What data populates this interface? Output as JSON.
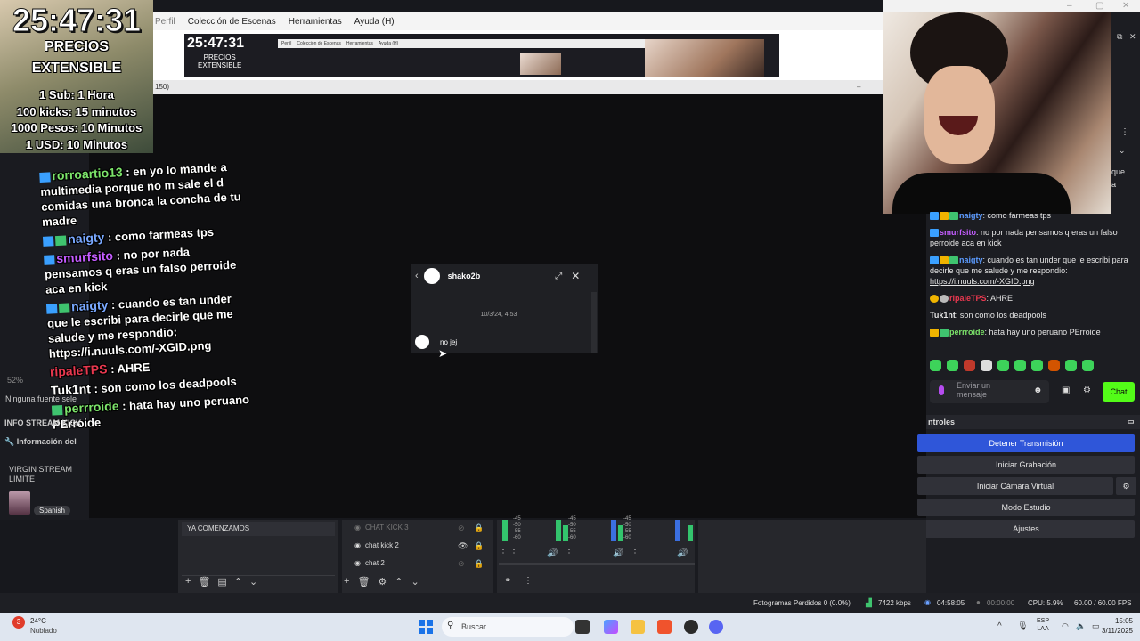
{
  "menubar": {
    "items": [
      "Perfil",
      "Colección de Escenas",
      "Herramientas",
      "Ayuda (H)"
    ]
  },
  "preview": {
    "timer": "25:47:31",
    "lines": [
      "PRECIOS",
      "EXTENSIBLE"
    ]
  },
  "subbar_text": "150)",
  "overlay": {
    "timer": "25:47:31",
    "title1": "PRECIOS",
    "title2": "EXTENSIBLE",
    "prices": [
      "1 Sub: 1 Hora",
      "100 kicks: 15 minutos",
      "1000 Pesos: 10 Minutos",
      "1 USD: 10 Minutos"
    ]
  },
  "stream_chat": [
    {
      "name": "rorroartio13",
      "text": ": en yo lo mande a multimedia porque no m sale el d comidas una bronca",
      "tail": "la concha de tu madre"
    },
    {
      "name": "naigty",
      "text": ": como farmeas tps"
    },
    {
      "name": "smurfsito",
      "text": ": no por nada pensamos q eras un falso perroide aca en kick"
    },
    {
      "name": "naigty",
      "text": ": cuando es tan under que le escribi para decirle que me salude y me respondio: https://i.nuuls.com/-XGID.png"
    },
    {
      "name": "ripaleTPS",
      "text": ": AHRE"
    },
    {
      "name": "Tuk1nt",
      "text": ": son como los deadpools"
    },
    {
      "name": "perrroide",
      "text": ": hata hay uno peruano PErroide"
    }
  ],
  "left_dock": {
    "zoom": "52%",
    "source_none": "Ninguna fuente sele",
    "info_title": "INFO STREAM KICK",
    "info_item": "Información del",
    "stream_title": "VIRGIN STREAM LIMITE",
    "language": "Spanish"
  },
  "dm": {
    "user": "shako2b",
    "date": "10/3/24, 4:53",
    "message": "no jej"
  },
  "right_chat": [
    {
      "name": "naigty",
      "name_color": "#5b9bff",
      "text": ": como farmeas tps"
    },
    {
      "name": "smurfsito",
      "name_color": "#c45cff",
      "text": ": no por nada pensamos q eras un falso perroide aca en kick"
    },
    {
      "name": "naigty",
      "name_color": "#5b9bff",
      "text": ": cuando es tan under que le escribi para decirle que me salude y me respondio:",
      "link": "https://i.nuuls.com/-XGID.png"
    },
    {
      "name": "ripaleTPS",
      "name_color": "#e8384f",
      "text": ": AHRE"
    },
    {
      "name": "Tuk1nt",
      "name_color": "#e6e6e6",
      "text": ": son como los deadpools"
    },
    {
      "name": "perrroide",
      "name_color": "#7ce46a",
      "text": ": hata hay uno peruano PErroide"
    }
  ],
  "right_side_text": [
    "que",
    "a"
  ],
  "chat_input": {
    "placeholder_line1": "Enviar un",
    "placeholder_line2": "mensaje",
    "send_label": "Chat"
  },
  "controls": {
    "title": "ntroles",
    "stop_stream": "Detener Transmisión",
    "start_recording": "Iniciar Grabación",
    "start_vcam": "Iniciar Cámara Virtual",
    "studio_mode": "Modo Estudio",
    "settings": "Ajustes"
  },
  "scenes": {
    "current": "YA COMENZAMOS"
  },
  "sources": [
    {
      "label": "CHAT KICK 3",
      "visible": false
    },
    {
      "label": "chat kick 2",
      "visible": true
    },
    {
      "label": "chat 2",
      "visible": false
    }
  ],
  "mixer_scale": [
    "-45",
    "-50",
    "-55",
    "-60"
  ],
  "status": {
    "dropped_frames": "Fotogramas Perdidos 0 (0.0%)",
    "bitrate": "7422 kbps",
    "live_time": "04:58:05",
    "rec_time": "00:00:00",
    "cpu": "CPU: 5.9%",
    "fps": "60.00 / 60.00 FPS"
  },
  "taskbar": {
    "temp": "24°C",
    "weather": "Nublado",
    "weather_badge": "3",
    "search_placeholder": "Buscar",
    "lang1": "ESP",
    "lang2": "LAA",
    "time": "15:05",
    "date": "3/11/2025"
  }
}
